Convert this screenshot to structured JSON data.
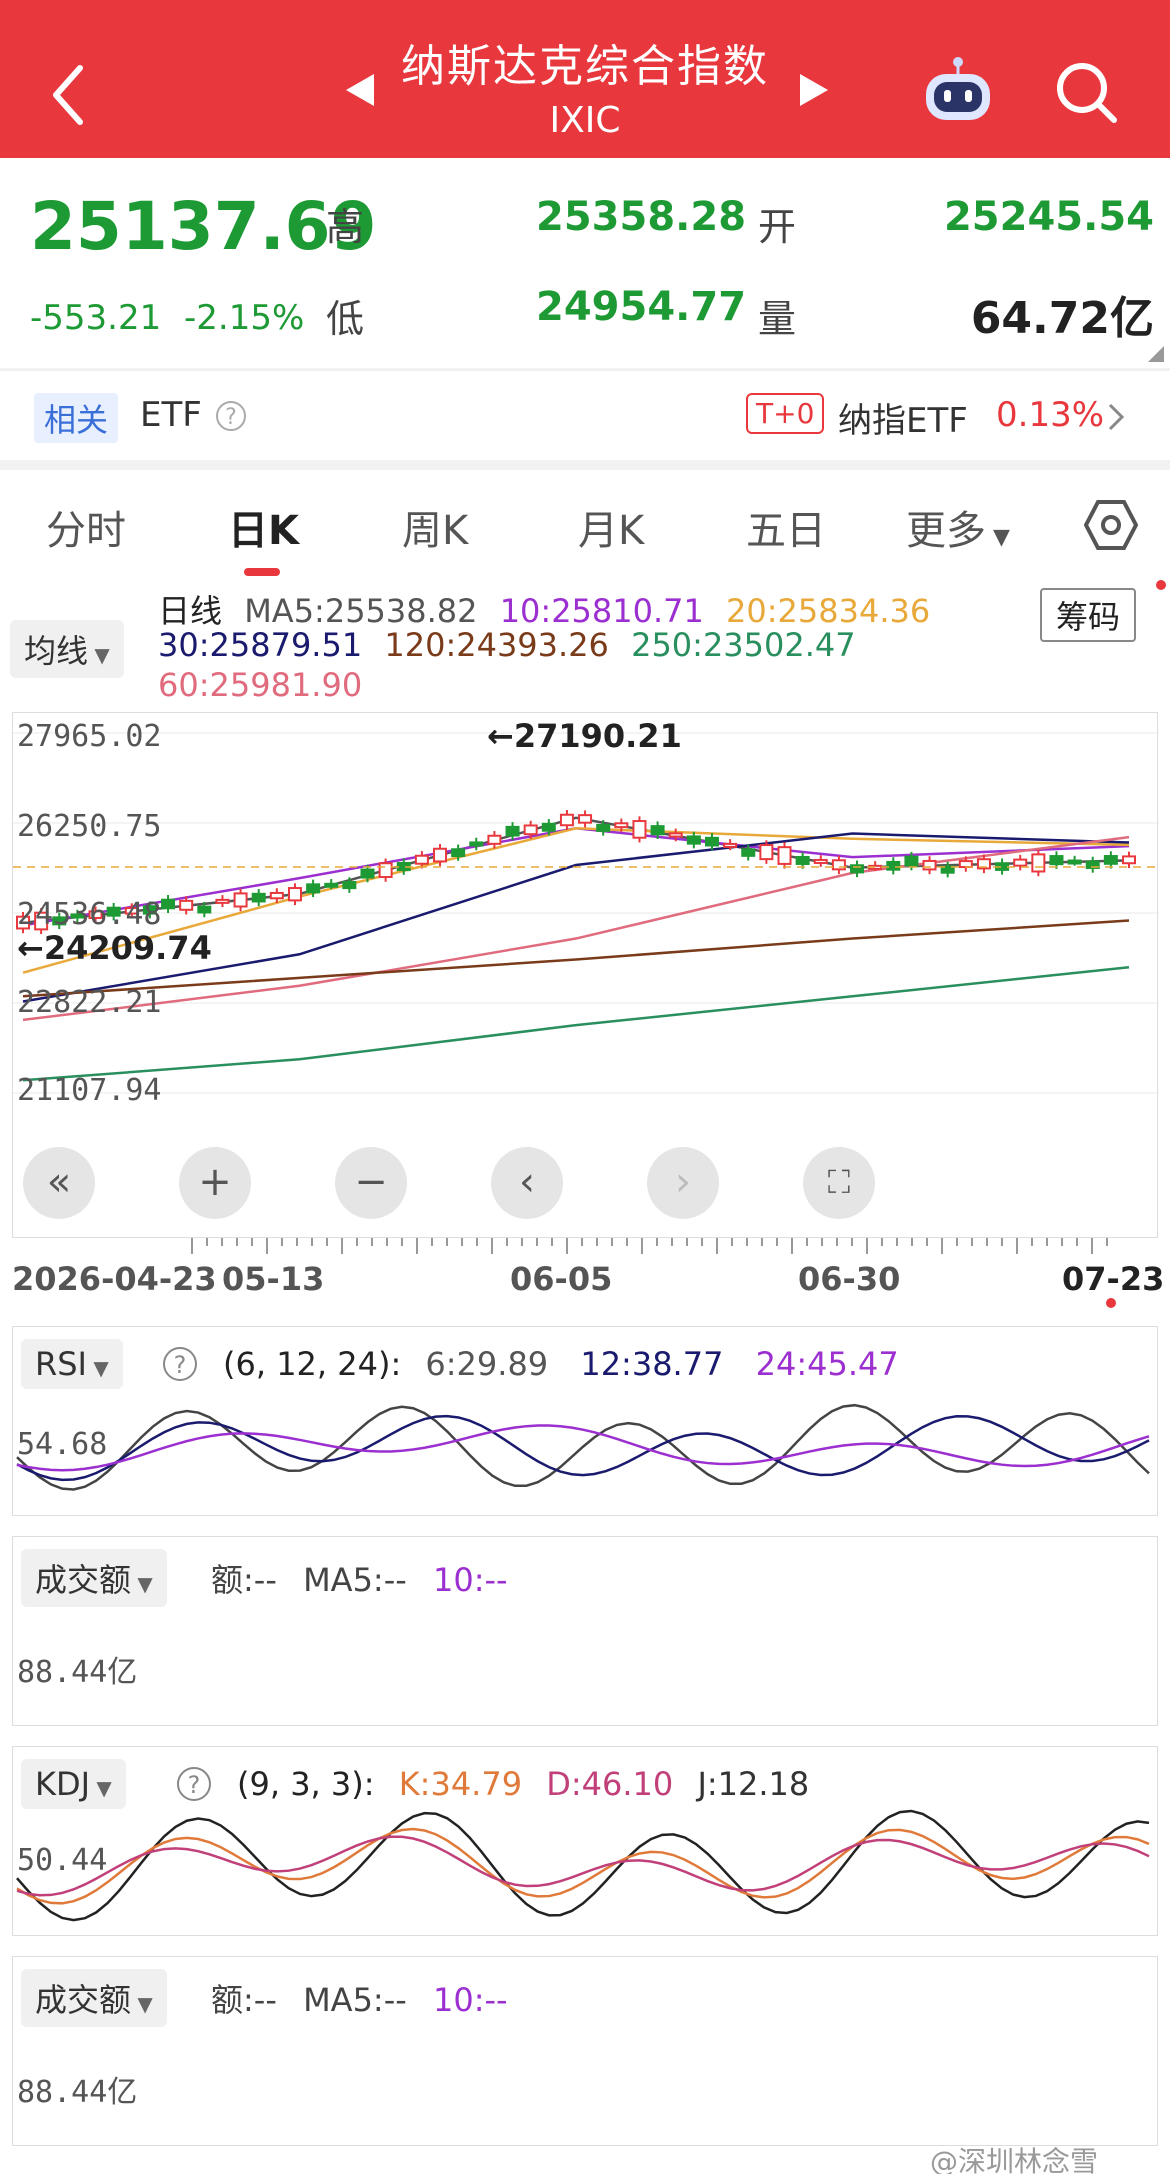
{
  "header": {
    "title": "纳斯达克综合指数",
    "code": "IXIC"
  },
  "quote": {
    "price": "25137.69",
    "change": "-553.21",
    "change_pct": "-2.15%",
    "high_label": "高",
    "high": "25358.28",
    "low_label": "低",
    "low": "24954.77",
    "open_label": "开",
    "open": "25245.54",
    "volume_label": "量",
    "volume": "64.72亿"
  },
  "etf_bar": {
    "related_badge": "相关",
    "etf_label": "ETF",
    "t0_badge": "T+0",
    "etf_name": "纳指ETF",
    "etf_change": "0.13%"
  },
  "tabs": [
    {
      "label": "分时"
    },
    {
      "label": "日K"
    },
    {
      "label": "周K"
    },
    {
      "label": "月K"
    },
    {
      "label": "五日"
    },
    {
      "label": "更多"
    }
  ],
  "main_chart": {
    "ma_selector": "均线",
    "chip_button": "筹码",
    "legend_line1": {
      "prefix": "日线",
      "ma5": "MA5:25538.82",
      "ma10": "10:25810.71",
      "ma20": "20:25834.36"
    },
    "legend_line2": {
      "ma30": "30:25879.51",
      "ma120": "120:24393.26",
      "ma250": "250:23502.47"
    },
    "legend_line3": {
      "ma60": "60:25981.90"
    },
    "y_labels": [
      "27965.02",
      "26250.75",
      "24536.48",
      "22822.21",
      "21107.94"
    ],
    "high_marker": "←27190.21",
    "low_marker": "←24209.74",
    "x_labels": [
      "2026-04-23",
      "05-13",
      "06-05",
      "06-30",
      "07-23"
    ],
    "colors": {
      "up": "#e8383d",
      "down": "#1e9a35",
      "ma5": "#555555",
      "ma10": "#9b2fd0",
      "ma20": "#e8a93a",
      "ma30": "#1a1a6e",
      "ma60": "#e06b7d",
      "ma120": "#7a3b1a",
      "ma250": "#2a8f5e"
    }
  },
  "rsi_panel": {
    "selector": "RSI",
    "params": "(6, 12, 24):",
    "v6": "6:29.89",
    "v12": "12:38.77",
    "v24": "24:45.47",
    "y_label": "54.68"
  },
  "volume_panel_1": {
    "selector": "成交额",
    "amount": "额:--",
    "ma5": "MA5:--",
    "ma10": "10:--",
    "y_label": "88.44亿"
  },
  "kdj_panel": {
    "selector": "KDJ",
    "params": "(9, 3, 3):",
    "k": "K:34.79",
    "d": "D:46.10",
    "j": "J:12.18",
    "y_label": "50.44"
  },
  "volume_panel_2": {
    "selector": "成交额",
    "amount": "额:--",
    "ma5": "MA5:--",
    "ma10": "10:--",
    "y_label": "88.44亿"
  },
  "watermark": "@深圳林念雪",
  "chart_data": {
    "type": "line",
    "title": "",
    "x": [
      "2026-04-23",
      "05-13",
      "06-05",
      "06-30",
      "07-23"
    ],
    "ylim": [
      21107.94,
      27965.02
    ],
    "series": [
      {
        "name": "MA5",
        "values": [
          24350,
          24900,
          26350,
          25400,
          25538.82
        ]
      },
      {
        "name": "10",
        "values": [
          24300,
          25200,
          26150,
          25600,
          25810.71
        ]
      },
      {
        "name": "20",
        "values": [
          23400,
          24850,
          26150,
          25950,
          25834.36
        ]
      },
      {
        "name": "30",
        "values": [
          22850,
          23750,
          25450,
          26050,
          25879.51
        ]
      },
      {
        "name": "60",
        "values": [
          22500,
          23150,
          24050,
          25300,
          25981.9
        ]
      },
      {
        "name": "120",
        "values": [
          22950,
          23300,
          23650,
          24050,
          24393.26
        ]
      },
      {
        "name": "250",
        "values": [
          21350,
          21750,
          22400,
          22950,
          23502.47
        ]
      }
    ]
  }
}
